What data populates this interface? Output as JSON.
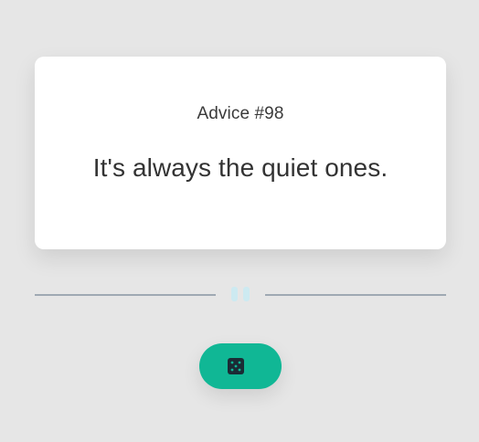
{
  "advice": {
    "id_label": "Advice #98",
    "text": "It's always the quiet ones."
  },
  "divider": {
    "icon": "pause-icon",
    "line_color": "#9fa9b3",
    "icon_color": "#cdeaf1"
  },
  "dice_button": {
    "icon": "dice-icon",
    "background": "#10b795"
  },
  "colors": {
    "page_background": "#e6e6e6",
    "card_background": "#ffffff",
    "text": "#333333"
  }
}
